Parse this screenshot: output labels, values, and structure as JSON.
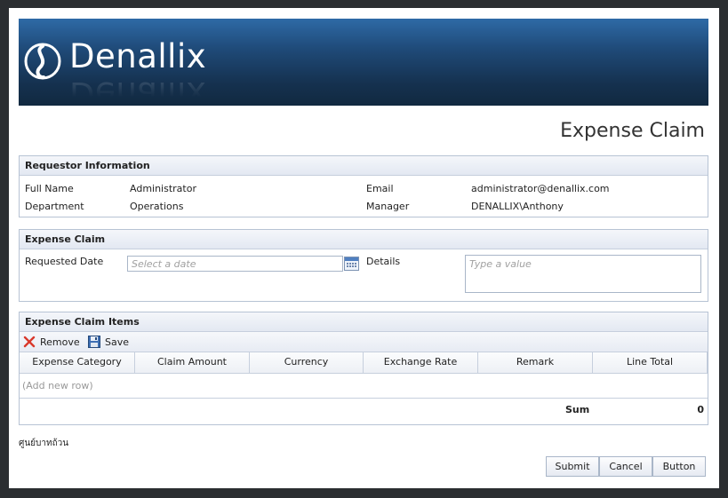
{
  "banner": {
    "logo_text": "Denallix"
  },
  "page_title": "Expense Claim",
  "requestor": {
    "header": "Requestor Information",
    "full_name_label": "Full Name",
    "full_name_value": "Administrator",
    "department_label": "Department",
    "department_value": "Operations",
    "email_label": "Email",
    "email_value": "administrator@denallix.com",
    "manager_label": "Manager",
    "manager_value": "DENALLIX\\Anthony"
  },
  "claim": {
    "header": "Expense Claim",
    "requested_date_label": "Requested Date",
    "requested_date_placeholder": "Select a date",
    "details_label": "Details",
    "details_placeholder": "Type a value"
  },
  "items": {
    "header": "Expense Claim Items",
    "remove_label": "Remove",
    "save_label": "Save",
    "columns": [
      "Expense Category",
      "Claim Amount",
      "Currency",
      "Exchange Rate",
      "Remark",
      "Line Total"
    ],
    "add_row_label": "(Add new row)",
    "sum_label": "Sum",
    "sum_value": "0"
  },
  "thai_text": "ศูนย์บาทถ้วน",
  "buttons": {
    "submit": "Submit",
    "cancel": "Cancel",
    "button": "Button"
  },
  "colors": {
    "banner_top": "#2e6aa6",
    "banner_bottom": "#112940",
    "section_border": "#b7c3d4",
    "remove_icon": "#d9382b"
  }
}
